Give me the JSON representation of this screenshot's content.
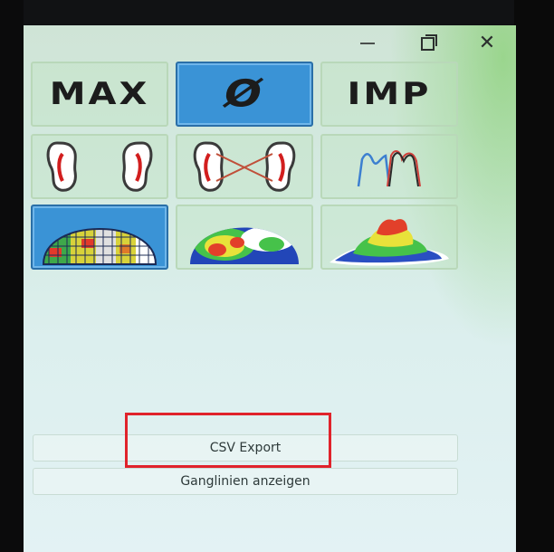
{
  "window": {
    "controls": [
      "minimize-icon",
      "maximize-icon",
      "close-icon"
    ]
  },
  "modes": [
    {
      "label": "MAX",
      "active": false
    },
    {
      "label": "Ø",
      "active": true
    },
    {
      "label": "IMP",
      "active": false
    }
  ],
  "views": [
    {
      "icon": "two-feet-outline-icon",
      "active": false
    },
    {
      "icon": "feet-crossed-lines-icon",
      "active": false
    },
    {
      "icon": "pressure-curve-icon",
      "active": false
    },
    {
      "icon": "grid-pressure-map-icon",
      "active": true
    },
    {
      "icon": "heatmap-2d-icon",
      "active": false
    },
    {
      "icon": "heatmap-3d-icon",
      "active": false
    }
  ],
  "buttons": {
    "csv_export": "CSV Export",
    "show_curves": "Ganglinien anzeigen"
  },
  "colors": {
    "active_tile": "#3a93d6",
    "highlight_border": "#e0232b"
  }
}
